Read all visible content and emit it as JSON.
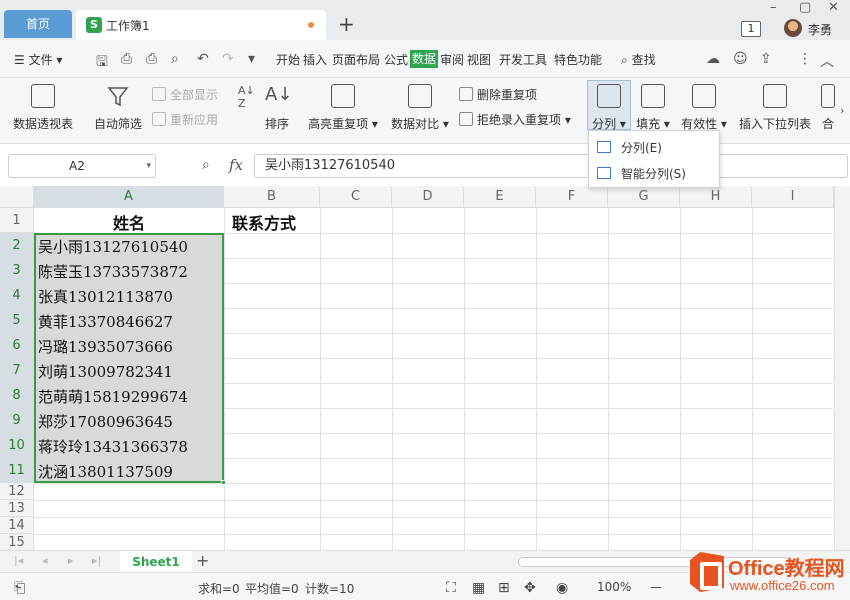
{
  "titlebar": {
    "home_tab": "首页",
    "doc_tab": "工作簿1",
    "doc_icon": "S",
    "new_tab": "+",
    "badge": "1",
    "user_name": "李勇",
    "minimize": "–",
    "restore": "▢",
    "close": "✕"
  },
  "menubar": {
    "file": "文件",
    "tabs": [
      "开始",
      "插入",
      "页面布局",
      "公式",
      "数据",
      "审阅",
      "视图",
      "开发工具",
      "特色功能"
    ],
    "active_tab": "数据",
    "search": "查找"
  },
  "ribbon": {
    "pivot": "数据透视表",
    "autofilter": "自动筛选",
    "show_all": "全部显示",
    "reapply": "重新应用",
    "sort": "排序",
    "highlight_dup": "高亮重复项",
    "delete_dup": "删除重复项",
    "reject_dup": "拒绝录入重复项",
    "compare": "数据对比",
    "split": "分列",
    "fill": "填充",
    "validity": "有效性",
    "dropdown_list": "插入下拉列表",
    "merge": "合"
  },
  "dropdown": {
    "item1": "分列(E)",
    "item2": "智能分列(S)"
  },
  "formula": {
    "namebox": "A2",
    "fx": "fx",
    "value": "吴小雨13127610540"
  },
  "grid": {
    "columns": [
      "A",
      "B",
      "C",
      "D",
      "E",
      "F",
      "G",
      "H",
      "I"
    ],
    "rows": [
      "1",
      "2",
      "3",
      "4",
      "5",
      "6",
      "7",
      "8",
      "9",
      "10",
      "11",
      "12",
      "13",
      "14",
      "15"
    ],
    "header_a": "姓名",
    "header_b": "联系方式",
    "data": [
      "吴小雨13127610540",
      "陈莹玉13733573872",
      "张真13012113870",
      "黄菲13370846627",
      "冯璐13935073666",
      "刘萌13009782341",
      "范萌萌15819299674",
      "郑莎17080963645",
      "蒋玲玲13431366378",
      "沈涵13801137509"
    ]
  },
  "sheets": {
    "active": "Sheet1",
    "add": "+"
  },
  "status": {
    "sum": "求和=0",
    "avg": "平均值=0",
    "count": "计数=10",
    "zoom": "100%"
  },
  "watermark": {
    "title": "Office教程网",
    "url": "www.office26.com"
  },
  "colors": {
    "accent_green": "#2ea44f",
    "selection_border": "#3b9b45",
    "home_tab": "#5b9bd5",
    "watermark": "#e8541f"
  }
}
